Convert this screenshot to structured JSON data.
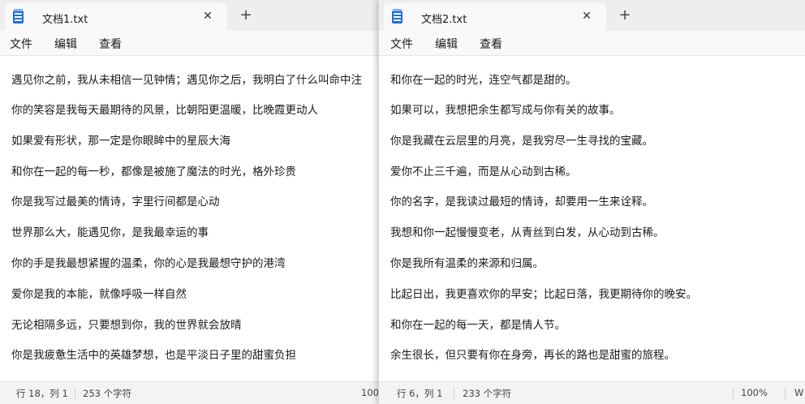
{
  "window1": {
    "tab_title": "文档1.txt",
    "close_glyph": "✕",
    "new_tab_glyph": "+",
    "menu": [
      "文件",
      "编辑",
      "查看"
    ],
    "lines": [
      "遇见你之前，我从未相信一见钟情；遇见你之后，我明白了什么叫命中注",
      "你的笑容是我每天最期待的风景，比朝阳更温暖，比晚霞更动人",
      "如果爱有形状，那一定是你眼眸中的星辰大海",
      "和你在一起的每一秒，都像是被施了魔法的时光，格外珍贵",
      "你是我写过最美的情诗，字里行间都是心动",
      "世界那么大，能遇见你，是我最幸运的事",
      "你的手是我最想紧握的温柔，你的心是我最想守护的港湾",
      "爱你是我的本能，就像呼吸一样自然",
      "无论相隔多远，只要想到你，我的世界就会放晴",
      "你是我疲惫生活中的英雄梦想，也是平淡日子里的甜蜜负担"
    ],
    "status": {
      "position": "行 18，列 1",
      "chars": "253 个字符",
      "zoom": "100"
    }
  },
  "window2": {
    "tab_title": "文档2.txt",
    "close_glyph": "✕",
    "new_tab_glyph": "+",
    "menu": [
      "文件",
      "编辑",
      "查看"
    ],
    "lines": [
      "和你在一起的时光，连空气都是甜的。",
      "如果可以，我想把余生都写成与你有关的故事。",
      "你是我藏在云层里的月亮，是我穷尽一生寻找的宝藏。",
      "爱你不止三千遍，而是从心动到古稀。",
      "你的名字，是我读过最短的情诗，却要用一生来诠释。",
      "我想和你一起慢慢变老，从青丝到白发，从心动到古稀。",
      "你是我所有温柔的来源和归属。",
      "比起日出，我更喜欢你的早安；比起日落，我更期待你的晚安。",
      "和你在一起的每一天，都是情人节。",
      "余生很长，但只要有你在身旁，再长的路也是甜蜜的旅程。"
    ],
    "status": {
      "position": "行 6，列 1",
      "chars": "233 个字符",
      "zoom": "100%",
      "encoding": "W"
    }
  }
}
